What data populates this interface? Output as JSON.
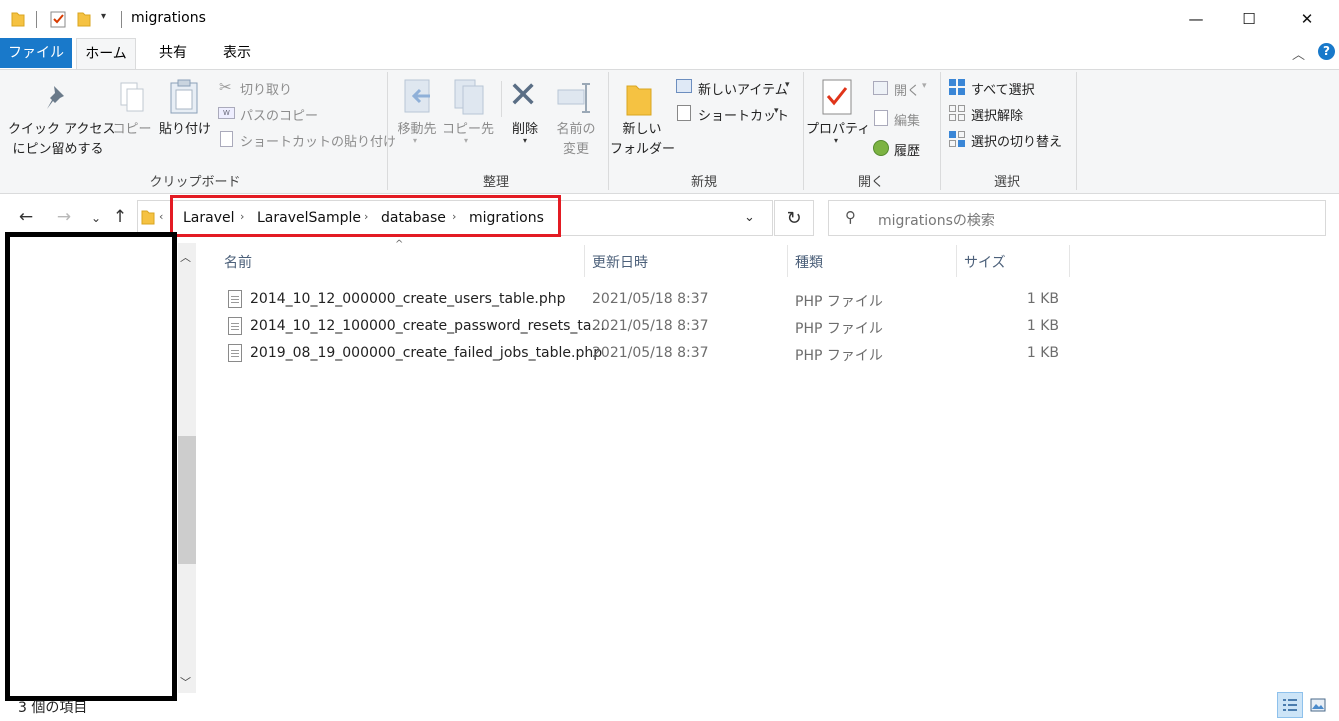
{
  "window": {
    "title": "migrations",
    "controls": {
      "minimize": "—",
      "maximize": "☐",
      "close": "✕"
    }
  },
  "ribbon_tabs": [
    "ファイル",
    "ホーム",
    "共有",
    "表示"
  ],
  "ribbon": {
    "clipboard": {
      "label": "クリップボード",
      "pin_line1": "クイック アクセス",
      "pin_line2": "にピン留めする",
      "copy": "コピー",
      "paste": "貼り付け",
      "cut": "切り取り",
      "copy_path": "パスのコピー",
      "paste_shortcut": "ショートカットの貼り付け"
    },
    "organize": {
      "label": "整理",
      "move_to": "移動先",
      "copy_to": "コピー先",
      "delete": "削除",
      "rename_line1": "名前の",
      "rename_line2": "変更"
    },
    "new": {
      "label": "新規",
      "new_folder_line1": "新しい",
      "new_folder_line2": "フォルダー",
      "new_item": "新しいアイテム",
      "shortcut": "ショートカット"
    },
    "open": {
      "label": "開く",
      "properties": "プロパティ",
      "open": "開く",
      "edit": "編集",
      "history": "履歴"
    },
    "select": {
      "label": "選択",
      "select_all": "すべて選択",
      "select_none": "選択解除",
      "invert": "選択の切り替え"
    }
  },
  "address": {
    "crumbs": [
      "Laravel",
      "LaravelSample",
      "database",
      "migrations"
    ],
    "search_placeholder": "migrationsの検索"
  },
  "columns": [
    "名前",
    "更新日時",
    "種類",
    "サイズ"
  ],
  "files": [
    {
      "name": "2014_10_12_000000_create_users_table.php",
      "modified": "2021/05/18 8:37",
      "type": "PHP ファイル",
      "size": "1 KB"
    },
    {
      "name": "2014_10_12_100000_create_password_resets_ta...",
      "modified": "2021/05/18 8:37",
      "type": "PHP ファイル",
      "size": "1 KB"
    },
    {
      "name": "2019_08_19_000000_create_failed_jobs_table.php",
      "modified": "2021/05/18 8:37",
      "type": "PHP ファイル",
      "size": "1 KB"
    }
  ],
  "status": {
    "item_count": "3 個の項目"
  },
  "colors": {
    "accent": "#1979ca",
    "highlight_box": "#e31b23",
    "folder": "#f5c242"
  }
}
